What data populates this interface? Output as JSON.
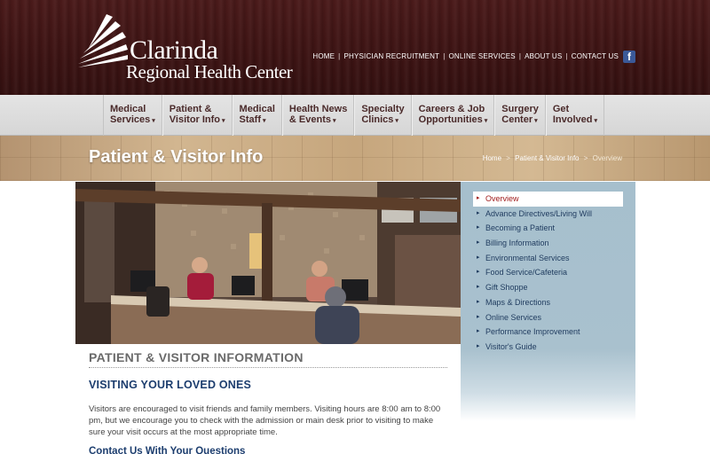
{
  "header": {
    "logo_name": "Clarinda",
    "logo_subtitle": "Regional Health Center",
    "top_links": [
      "HOME",
      "PHYSICIAN RECRUITMENT",
      "ONLINE SERVICES",
      "ABOUT US",
      "CONTACT US"
    ],
    "facebook_glyph": "f"
  },
  "nav": {
    "items": [
      {
        "line1": "Medical",
        "line2": "Services"
      },
      {
        "line1": "Patient &",
        "line2": "Visitor Info"
      },
      {
        "line1": "Medical",
        "line2": "Staff"
      },
      {
        "line1": "Health News",
        "line2": "& Events"
      },
      {
        "line1": "Specialty",
        "line2": "Clinics"
      },
      {
        "line1": "Careers & Job",
        "line2": "Opportunities"
      },
      {
        "line1": "Surgery",
        "line2": "Center"
      },
      {
        "line1": "Get",
        "line2": "Involved"
      }
    ],
    "caret": "▾"
  },
  "banner": {
    "title": "Patient & Visitor Info",
    "breadcrumb": [
      "Home",
      "Patient & Visitor Info",
      "Overview"
    ],
    "separator": ">"
  },
  "content": {
    "heading": "PATIENT & VISITOR INFORMATION",
    "subheading": "VISITING YOUR LOVED ONES",
    "paragraph": "Visitors are encouraged to visit friends and family members. Visiting hours are 8:00 am to 8:00 pm, but we encourage you to check with the admission or main desk prior to visiting to make sure your visit occurs at the most appropriate time.",
    "contact_heading": "Contact Us With Your Questions"
  },
  "sidebar": {
    "items": [
      "Overview",
      "Advance Directives/Living Will",
      "Becoming a Patient",
      "Billing Information",
      "Environmental Services",
      "Food Service/Cafeteria",
      "Gift Shoppe",
      "Maps & Directions",
      "Online Services",
      "Performance Improvement",
      "Visitor's Guide"
    ],
    "active_index": 0,
    "arrow": "▸"
  },
  "colors": {
    "header_bg": "#3c1313",
    "nav_text": "#4a2a2a",
    "banner_bg": "#c8aa84",
    "heading_blue": "#1c3d6e",
    "sidebar_bg": "#a6bfcd",
    "active_red": "#a01c1c"
  },
  "icons": {
    "logo": "sunburst-logo-icon",
    "facebook": "facebook-icon",
    "photo": "reception-desk-photo"
  }
}
